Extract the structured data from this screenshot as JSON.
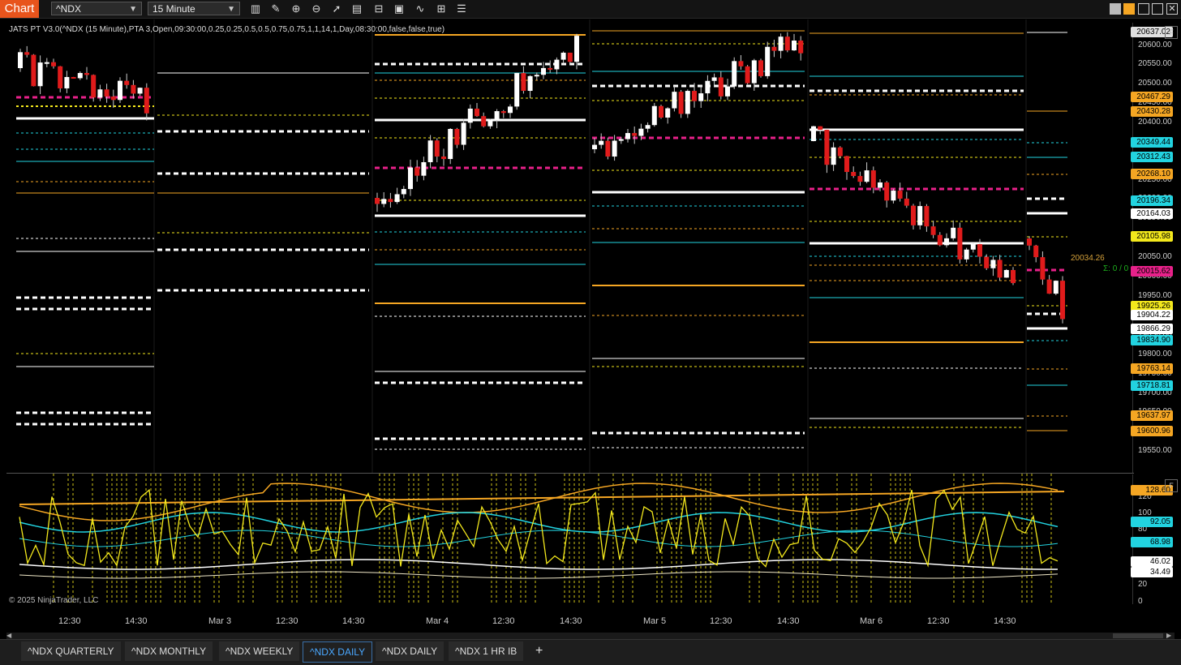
{
  "app": {
    "tab_label": "Chart"
  },
  "toolbar": {
    "instrument": "^NDX",
    "interval": "15 Minute",
    "tools": [
      "bar-type-icon",
      "pencil-icon",
      "zoom-in-icon",
      "zoom-out-icon",
      "pointer-icon",
      "properties-icon",
      "layout-icon",
      "template-icon",
      "indicator-icon",
      "strategy-icon",
      "list-icon"
    ]
  },
  "indicator_title": "JATS PT V3.0(^NDX (15 Minute),PTA 3,Open,09:30:00,0.25,0.25,0.5,0.5,0.75,0.75,1,1,14,1,Day,08:30:00,false,false,true)",
  "copyright": "© 2025 NinjaTrader, LLC",
  "price_axis": {
    "ticks": [
      "20600.00",
      "20550.00",
      "20500.00",
      "20450.00",
      "20400.00",
      "20350.00",
      "20300.00",
      "20250.00",
      "20200.00",
      "20150.00",
      "20100.00",
      "20050.00",
      "20000.00",
      "19950.00",
      "19900.00",
      "19850.00",
      "19800.00",
      "19750.00",
      "19700.00",
      "19650.00",
      "19600.00",
      "19550.00"
    ],
    "badges": [
      {
        "value": "20637.02",
        "color": "#e0e0e0"
      },
      {
        "value": "20467.29",
        "color": "#f5a623"
      },
      {
        "value": "20430.28",
        "color": "#f5a623"
      },
      {
        "value": "20349.44",
        "color": "#22d3e0"
      },
      {
        "value": "20312.43",
        "color": "#22d3e0"
      },
      {
        "value": "20268.10",
        "color": "#f5a623"
      },
      {
        "value": "20196.34",
        "color": "#22d3e0"
      },
      {
        "value": "20164.03",
        "color": "#ffffff"
      },
      {
        "value": "20105.98",
        "color": "#f3e81c"
      },
      {
        "value": "20015.62",
        "color": "#e8218a"
      },
      {
        "value": "19925.26",
        "color": "#f3e81c"
      },
      {
        "value": "19904.22",
        "color": "#ffffff"
      },
      {
        "value": "19866.29",
        "color": "#ffffff"
      },
      {
        "value": "19834.90",
        "color": "#22d3e0"
      },
      {
        "value": "19763.14",
        "color": "#f5a623"
      },
      {
        "value": "19718.81",
        "color": "#22d3e0"
      },
      {
        "value": "19637.97",
        "color": "#f5a623"
      },
      {
        "value": "19600.96",
        "color": "#f5a623"
      }
    ],
    "last_price": "20034.26",
    "sigma": "Σ: 0 / 0"
  },
  "lower_axis": {
    "ticks": [
      "120",
      "100",
      "80",
      "60",
      "40",
      "20",
      "0"
    ],
    "badges": [
      {
        "value": "128.60",
        "color": "#f5a623"
      },
      {
        "value": "92.05",
        "color": "#22d3e0"
      },
      {
        "value": "68.98",
        "color": "#22d3e0"
      },
      {
        "value": "46.02",
        "color": "#ffffff"
      },
      {
        "value": "34.49",
        "color": "#ffffff"
      }
    ]
  },
  "x_axis": [
    "12:30",
    "14:30",
    "Mar 3",
    "12:30",
    "14:30",
    "Mar 4",
    "12:30",
    "14:30",
    "Mar 5",
    "12:30",
    "14:30",
    "Mar 6",
    "12:30",
    "14:30"
  ],
  "tabs": [
    "^NDX QUARTERLY",
    "^NDX MONTHLY",
    "^NDX WEEKLY",
    "^NDX DAILY",
    "^NDX DAILY",
    "^NDX 1 HR IB"
  ],
  "active_tab": "^NDX DAILY",
  "add_tab": "+",
  "panel_buttons": [
    "F",
    "F"
  ],
  "colors": {
    "accent": "#e8541c",
    "up": "#ffffff",
    "down": "#e01b1b",
    "orange": "#f5a623",
    "cyan": "#22d3e0",
    "yellow": "#f3e81c",
    "magenta": "#e8218a"
  }
}
